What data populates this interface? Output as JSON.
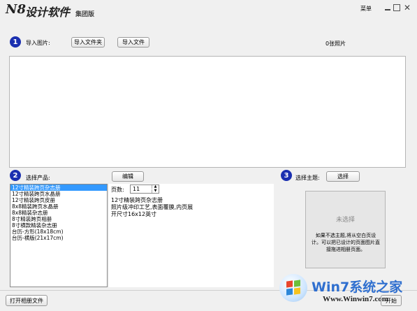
{
  "app": {
    "logo": "N8",
    "title": "设计软件",
    "edition": "集团版"
  },
  "titlebar": {
    "menu_label": "菜单"
  },
  "step1": {
    "number": "1",
    "label": "导入图片:",
    "import_folder": "导入文件夹",
    "import_file": "导入文件",
    "photo_count": "0张照片"
  },
  "step2": {
    "number": "2",
    "label": "选择产品:",
    "edit_button": "编辑",
    "products": [
      "12寸精装跨页杂志册",
      "12寸精装跨页水晶册",
      "12寸精装跨页皮册",
      "8x8精装跨页水晶册",
      "8x8精装杂志册",
      "8寸精装跨页相册",
      "8寸横款精装杂志册",
      "台历-方形(18x18cm)",
      "台历-横版(21x17cm)"
    ],
    "selected_index": 0,
    "pages_label": "页数:",
    "pages_value": "11",
    "product_name": "12寸精装跨页杂志册",
    "product_desc": "照片级冲印工艺,表面覆膜,内页展开尺寸16x12英寸"
  },
  "step3": {
    "number": "3",
    "label": "选择主题:",
    "select_button": "选择",
    "preview_state": "未选择",
    "hint": "如果不选主题,将从空白页设计。可以把已设计的页面图片直接拖进相册页面。"
  },
  "footer": {
    "open_album": "打开相册文件",
    "start": "开始"
  },
  "watermark": {
    "brand": "Win7系统之家",
    "url": "Www.Winwin7.com"
  },
  "colors": {
    "accent": "#1a2fb0",
    "selection": "#3399ff"
  }
}
